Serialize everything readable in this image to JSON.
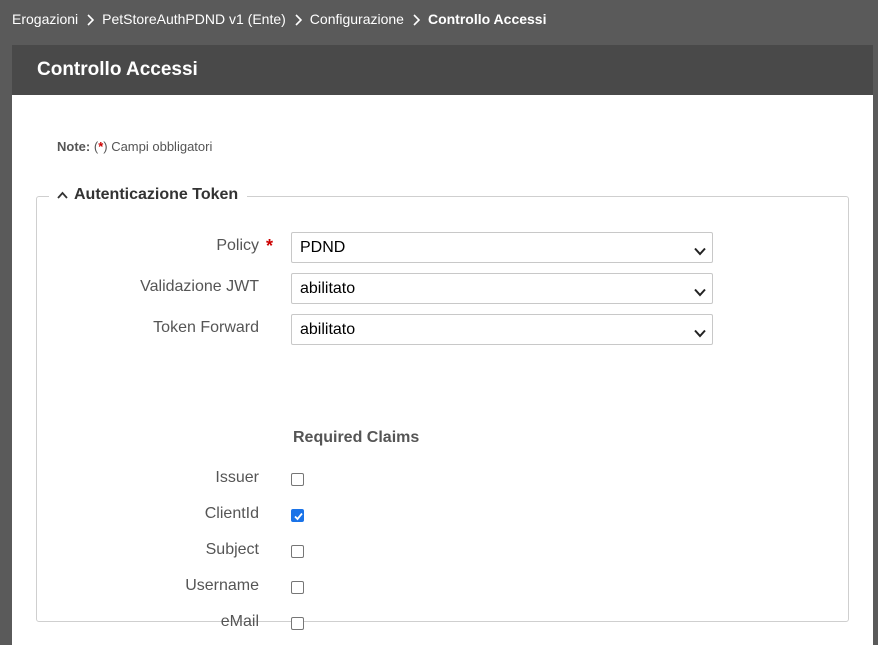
{
  "breadcrumb": {
    "items": [
      "Erogazioni",
      "PetStoreAuthPDND v1 (Ente)",
      "Configurazione",
      "Controllo Accessi"
    ]
  },
  "panel": {
    "title": "Controllo Accessi"
  },
  "note": {
    "label": "Note:",
    "open": "(",
    "star": "*",
    "text": ") Campi obbligatori"
  },
  "section": {
    "title": "Autenticazione Token",
    "fields": {
      "policy": {
        "label": "Policy",
        "required": "*",
        "value": "PDND"
      },
      "jwt": {
        "label": "Validazione JWT",
        "value": "abilitato"
      },
      "forward": {
        "label": "Token Forward",
        "value": "abilitato"
      }
    },
    "claims_title": "Required Claims",
    "claims": {
      "issuer": {
        "label": "Issuer",
        "checked": false
      },
      "clientid": {
        "label": "ClientId",
        "checked": true
      },
      "subject": {
        "label": "Subject",
        "checked": false
      },
      "username": {
        "label": "Username",
        "checked": false
      },
      "email": {
        "label": "eMail",
        "checked": false
      }
    }
  },
  "colors": {
    "header_bg": "#494949",
    "page_bg": "#5a5a5a",
    "required": "#cc0000",
    "check_accent": "#1a73e8"
  },
  "icons": {
    "breadcrumb_separator": "chevron-right-icon",
    "section_toggle": "chevron-up-icon",
    "select_arrow": "chevron-down-icon"
  }
}
